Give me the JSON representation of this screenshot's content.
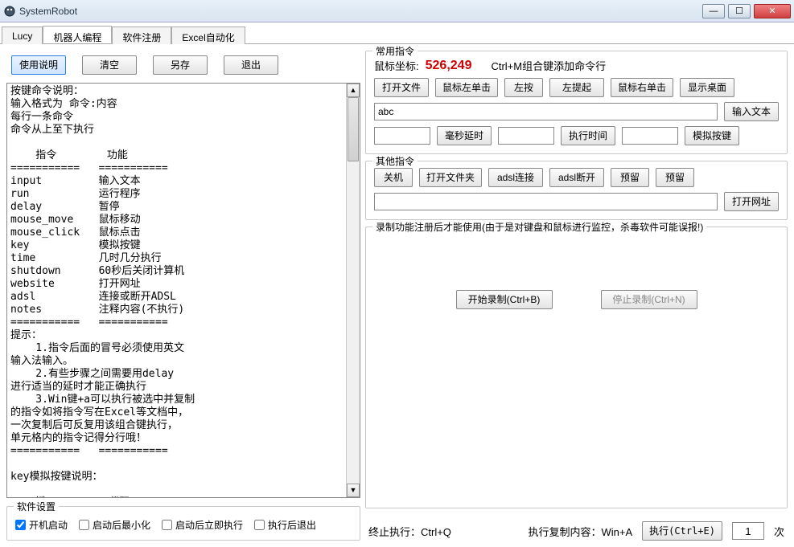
{
  "window": {
    "title": "SystemRobot"
  },
  "tabs": {
    "items": [
      "Lucy",
      "机器人编程",
      "软件注册",
      "Excel自动化"
    ],
    "activeIndex": 1
  },
  "leftToolbar": {
    "helpBtn": "使用说明",
    "clearBtn": "清空",
    "saveAsBtn": "另存",
    "exitBtn": "退出"
  },
  "scriptContent": "按键命令说明：\n输入格式为 命令:内容\n每行一条命令\n命令从上至下执行\n\n    指令        功能\n===========   ===========\ninput         输入文本\nrun           运行程序\ndelay         暂停\nmouse_move    鼠标移动\nmouse_click   鼠标点击\nkey           模拟按键\ntime          几时几分执行\nshutdown      60秒后关闭计算机\nwebsite       打开网址\nadsl          连接或断开ADSL\nnotes         注释内容(不执行)\n===========   ===========\n提示：\n    1.指令后面的冒号必须使用英文\n输入法输入。\n    2.有些步骤之间需要用delay\n进行适当的延时才能正确执行\n    3.Win键+a可以执行被选中并复制\n的指令如将指令写在Excel等文档中，\n一次复制后可反复用该组合键执行，\n单元格内的指令记得分行哦！\n===========   ===========\n\nkey模拟按键说明：\n\n    键          代码\n===========   ===========",
  "commonCmds": {
    "legend": "常用指令",
    "coordLabel": "鼠标坐标:",
    "coordValue": "526,249",
    "coordHint": "Ctrl+M组合键添加命令行",
    "openFile": "打开文件",
    "leftClick": "鼠标左单击",
    "leftDown": "左按",
    "leftUp": "左提起",
    "rightClick": "鼠标右单击",
    "showDesktop": "显示桌面",
    "textValue": "abc",
    "inputTextBtn": "输入文本",
    "msDelay": "毫秒延时",
    "execTime": "执行时间",
    "simKey": "模拟按键"
  },
  "otherCmds": {
    "legend": "其他指令",
    "shutdown": "关机",
    "openFolder": "打开文件夹",
    "adslConnect": "adsl连接",
    "adslDisconnect": "adsl断开",
    "reserve": "预留",
    "openSite": "打开网址"
  },
  "record": {
    "legend": "录制功能注册后才能使用(由于是对键盘和鼠标进行监控，杀毒软件可能误报!)",
    "start": "开始录制(Ctrl+B)",
    "stop": "停止录制(Ctrl+N)"
  },
  "settings": {
    "legend": "软件设置",
    "autoStart": "开机启动",
    "minOnStart": "启动后最小化",
    "execOnStart": "启动后立即执行",
    "exitAfter": "执行后退出"
  },
  "footer": {
    "abortHint": "终止执行：Ctrl+Q",
    "copyHint": "执行复制内容：Win+A",
    "execBtn": "执行(Ctrl+E)",
    "times": "1",
    "timesSuffix": "次"
  }
}
